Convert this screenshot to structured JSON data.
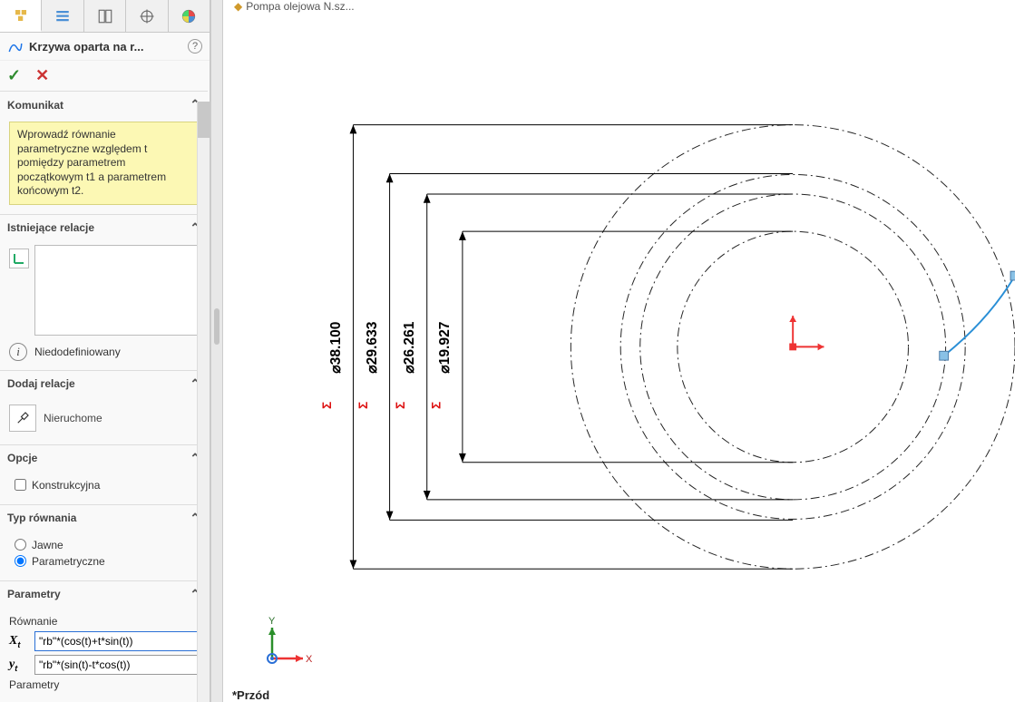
{
  "header": {
    "title": "Krzywa oparta na r..."
  },
  "doc_title": "Pompa olejowa N.sz...",
  "message": {
    "head": "Komunikat",
    "body": "Wprowadź równanie parametryczne względem t pomiędzy parametrem początkowym t1 a parametrem końcowym t2."
  },
  "existing": {
    "head": "Istniejące relacje",
    "status": "Niedodefiniowany"
  },
  "add_rel": {
    "head": "Dodaj relacje",
    "fix": "Nieruchome"
  },
  "options": {
    "head": "Opcje",
    "construction": "Konstrukcyjna"
  },
  "eq_type": {
    "head": "Typ równania",
    "explicit": "Jawne",
    "parametric": "Parametryczne"
  },
  "params": {
    "head": "Parametry",
    "eq_label": "Równanie",
    "x": "\"rb\"*(cos(t)+t*sin(t))",
    "y": "\"rb\"*(sin(t)-t*cos(t))",
    "sub_label": "Parametry"
  },
  "dims": {
    "d1": "⌀38.100",
    "d2": "⌀29.633",
    "d3": "⌀26.261",
    "d4": "⌀19.927"
  },
  "triad": {
    "x": "X",
    "y": "Y"
  },
  "status_bar": "*Przód"
}
